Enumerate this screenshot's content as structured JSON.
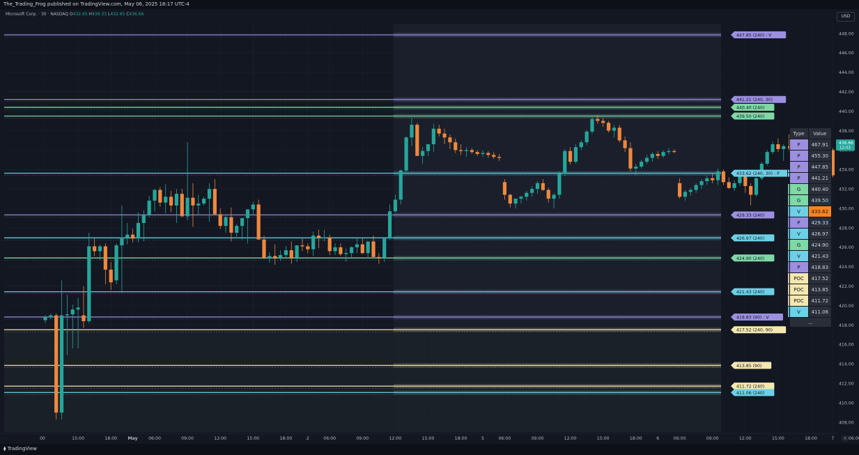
{
  "header": {
    "publisher": "The_Trading_Frog published on TradingView.com, May 06, 2025 18:17 UTC-4",
    "currency": "USD",
    "symbol": "Microsoft Corp. · 30 · NASDAQ",
    "ohlc": [
      {
        "k": "O",
        "v": "432.65"
      },
      {
        "k": "H",
        "v": "439.33"
      },
      {
        "k": "L",
        "v": "432.65"
      },
      {
        "k": "C",
        "v": "436.66"
      }
    ]
  },
  "footer": {
    "logo": "TradingView",
    "auto": "A"
  },
  "colors": {
    "background": "#131722",
    "up": "#26a69a",
    "down": "#f0883e",
    "p": "#9c8fe0",
    "g": "#7fd8a6",
    "v": "#6dd0e6",
    "poc": "#f5e7b0"
  },
  "chart_data": {
    "type": "candlestick",
    "ylim": [
      407,
      449
    ],
    "y_ticks": [
      "448.00",
      "446.00",
      "444.00",
      "442.00",
      "440.00",
      "438.00",
      "436.00",
      "434.00",
      "432.00",
      "430.00",
      "428.00",
      "426.00",
      "424.00",
      "422.00",
      "420.00",
      "418.00",
      "416.00",
      "414.00",
      "412.00",
      "410.00",
      "408.00"
    ],
    "last_price": {
      "value": "436.66",
      "countdown": "12:03"
    },
    "x_ticks": [
      {
        "label": "00",
        "bar": -0.5
      },
      {
        "label": "15:00",
        "bar": 6
      },
      {
        "label": "18:00",
        "bar": 12
      },
      {
        "label": "May",
        "bar": 16,
        "bold": true
      },
      {
        "label": "06:00",
        "bar": 20
      },
      {
        "label": "09:00",
        "bar": 26
      },
      {
        "label": "12:00",
        "bar": 32
      },
      {
        "label": "15:00",
        "bar": 38
      },
      {
        "label": "18:00",
        "bar": 44
      },
      {
        "label": "2",
        "bar": 48
      },
      {
        "label": "06:00",
        "bar": 52
      },
      {
        "label": "09:00",
        "bar": 58
      },
      {
        "label": "12:00",
        "bar": 64
      },
      {
        "label": "15:00",
        "bar": 70
      },
      {
        "label": "18:00",
        "bar": 76
      },
      {
        "label": "5",
        "bar": 80
      },
      {
        "label": "06:00",
        "bar": 84
      },
      {
        "label": "09:00",
        "bar": 90
      },
      {
        "label": "12:00",
        "bar": 96
      },
      {
        "label": "15:00",
        "bar": 102
      },
      {
        "label": "18:00",
        "bar": 108
      },
      {
        "label": "6",
        "bar": 112
      },
      {
        "label": "06:00",
        "bar": 116
      },
      {
        "label": "09:00",
        "bar": 122
      },
      {
        "label": "12:00",
        "bar": 128
      },
      {
        "label": "15:00",
        "bar": 134
      },
      {
        "label": "18:00",
        "bar": 140
      },
      {
        "label": "7",
        "bar": 144
      },
      {
        "label": "06:00",
        "bar": 148
      },
      {
        "label": "09:00",
        "bar": 154
      },
      {
        "label": "12:00",
        "bar": 160
      }
    ],
    "candles": [
      [
        418.5,
        419.0,
        418.2,
        418.8
      ],
      [
        418.8,
        419.2,
        418.6,
        419.0
      ],
      [
        419.0,
        419.2,
        408.3,
        409.0
      ],
      [
        409.0,
        422.6,
        408.3,
        419.0
      ],
      [
        419.0,
        421.1,
        414.9,
        419.1
      ],
      [
        419.1,
        420.1,
        415.6,
        419.6
      ],
      [
        419.6,
        420.8,
        415.6,
        419.8
      ],
      [
        419.0,
        422.0,
        417.7,
        418.4
      ],
      [
        418.4,
        427.5,
        418.2,
        426.1
      ],
      [
        426.1,
        426.9,
        425.1,
        425.6
      ],
      [
        425.6,
        426.3,
        424.7,
        426.1
      ],
      [
        426.1,
        426.4,
        422.2,
        423.7
      ],
      [
        423.7,
        424.5,
        421.6,
        422.4
      ],
      [
        422.6,
        426.4,
        422.2,
        426.2
      ],
      [
        426.2,
        430.3,
        421.3,
        427.0
      ],
      [
        427.0,
        428.5,
        426.3,
        427.3
      ],
      [
        427.3,
        427.9,
        426.5,
        426.9
      ],
      [
        426.9,
        429.6,
        426.5,
        428.5
      ],
      [
        428.5,
        429.8,
        426.6,
        429.3
      ],
      [
        429.3,
        431.3,
        429.1,
        430.8
      ],
      [
        430.8,
        432.0,
        429.7,
        431.9
      ],
      [
        431.9,
        432.2,
        430.2,
        430.6
      ],
      [
        430.6,
        432.5,
        429.5,
        431.2
      ],
      [
        431.2,
        431.8,
        429.6,
        430.3
      ],
      [
        430.3,
        432.0,
        428.5,
        431.5
      ],
      [
        431.5,
        432.0,
        429.1,
        429.2
      ],
      [
        429.2,
        436.8,
        428.8,
        431.1
      ],
      [
        431.1,
        432.6,
        428.1,
        430.3
      ],
      [
        430.3,
        431.4,
        429.4,
        430.5
      ],
      [
        430.5,
        431.2,
        430.3,
        431.0
      ],
      [
        431.0,
        432.6,
        428.6,
        432.0
      ],
      [
        432.0,
        433.0,
        431.2,
        429.4
      ],
      [
        429.4,
        430.0,
        427.9,
        428.2
      ],
      [
        428.2,
        429.3,
        427.5,
        429.1
      ],
      [
        429.1,
        430.1,
        426.6,
        427.5
      ],
      [
        427.5,
        428.4,
        427.1,
        428.2
      ],
      [
        428.2,
        428.8,
        426.8,
        429.0
      ],
      [
        429.0,
        429.9,
        426.4,
        429.9
      ],
      [
        429.9,
        430.7,
        429.4,
        430.4
      ],
      [
        430.4,
        430.9,
        427.6,
        426.8
      ],
      [
        426.8,
        427.2,
        424.8,
        424.9
      ],
      [
        424.9,
        425.5,
        424.4,
        425.1
      ],
      [
        425.1,
        426.3,
        424.2,
        424.9
      ],
      [
        424.9,
        425.7,
        424.6,
        425.2
      ],
      [
        425.2,
        426.1,
        424.9,
        425.7
      ],
      [
        425.7,
        426.6,
        424.3,
        424.9
      ],
      [
        424.9,
        425.8,
        424.5,
        426.2
      ],
      [
        426.2,
        426.9,
        425.6,
        426.1
      ],
      [
        426.1,
        426.4,
        425.4,
        425.8
      ],
      [
        425.8,
        427.6,
        425.1,
        427.2
      ],
      [
        427.2,
        427.8,
        425.9,
        427.0
      ],
      [
        427.0,
        427.8,
        426.6,
        427.0
      ],
      [
        427.0,
        427.3,
        425.2,
        425.6
      ],
      [
        425.6,
        426.4,
        425.2,
        426.0
      ],
      [
        426.0,
        426.4,
        425.1,
        425.3
      ],
      [
        425.3,
        425.9,
        424.5,
        425.4
      ],
      [
        425.4,
        426.1,
        425.0,
        426.0
      ],
      [
        426.0,
        426.9,
        425.4,
        426.3
      ],
      [
        426.3,
        426.9,
        425.3,
        425.4
      ],
      [
        425.4,
        426.5,
        424.9,
        426.6
      ],
      [
        426.6,
        427.2,
        425.0,
        425.0
      ],
      [
        425.0,
        425.4,
        424.3,
        424.9
      ],
      [
        424.9,
        426.2,
        424.5,
        426.9
      ],
      [
        426.9,
        430.4,
        426.8,
        429.7
      ],
      [
        429.7,
        431.4,
        429.6,
        430.9
      ],
      [
        430.9,
        434.0,
        430.4,
        433.9
      ],
      [
        433.9,
        437.4,
        433.6,
        437.3
      ],
      [
        437.3,
        439.3,
        436.4,
        438.6
      ],
      [
        438.6,
        438.8,
        435.5,
        435.4
      ],
      [
        435.4,
        436.3,
        434.6,
        435.9
      ],
      [
        435.9,
        436.4,
        435.4,
        436.6
      ],
      [
        436.6,
        438.7,
        435.8,
        438.2
      ],
      [
        438.2,
        438.6,
        437.4,
        437.7
      ],
      [
        437.7,
        438.2,
        436.6,
        437.3
      ],
      [
        437.3,
        437.6,
        436.1,
        436.8
      ],
      [
        436.8,
        437.2,
        435.7,
        436.0
      ],
      [
        436.0,
        436.6,
        435.5,
        435.9
      ],
      [
        435.9,
        436.3,
        435.3,
        436.0
      ],
      [
        436.0,
        436.2,
        435.6,
        435.8
      ],
      [
        435.8,
        436.0,
        435.4,
        435.6
      ],
      [
        435.6,
        436.0,
        435.3,
        435.7
      ],
      [
        435.7,
        435.9,
        435.2,
        435.5
      ],
      [
        435.5,
        435.8,
        435.1,
        435.3
      ],
      [
        435.3,
        435.6,
        434.9,
        435.2
      ],
      [
        432.7,
        433.0,
        430.9,
        431.4
      ],
      [
        431.4,
        431.5,
        430.1,
        430.5
      ],
      [
        430.5,
        431.0,
        430.0,
        431.0
      ],
      [
        431.0,
        431.3,
        430.5,
        431.2
      ],
      [
        431.2,
        431.8,
        430.8,
        431.6
      ],
      [
        431.6,
        432.3,
        431.2,
        432.0
      ],
      [
        432.0,
        432.8,
        431.5,
        432.6
      ],
      [
        432.6,
        433.0,
        431.8,
        431.9
      ],
      [
        431.9,
        432.1,
        430.6,
        431.0
      ],
      [
        431.0,
        431.6,
        430.0,
        431.4
      ],
      [
        431.4,
        433.8,
        431.0,
        433.6
      ],
      [
        433.6,
        436.1,
        433.3,
        435.9
      ],
      [
        435.9,
        436.3,
        434.5,
        434.8
      ],
      [
        434.8,
        436.6,
        434.6,
        436.3
      ],
      [
        436.3,
        437.0,
        436.0,
        436.8
      ],
      [
        436.8,
        438.1,
        436.5,
        437.9
      ],
      [
        437.9,
        439.4,
        437.7,
        439.2
      ],
      [
        439.2,
        439.6,
        438.7,
        439.0
      ],
      [
        439.0,
        439.3,
        438.4,
        438.8
      ],
      [
        438.8,
        439.0,
        437.8,
        438.0
      ],
      [
        438.0,
        438.6,
        437.3,
        438.3
      ],
      [
        438.3,
        438.6,
        436.8,
        437.0
      ],
      [
        437.0,
        437.4,
        435.8,
        436.2
      ],
      [
        436.2,
        436.8,
        433.8,
        434.1
      ],
      [
        434.1,
        434.6,
        433.4,
        434.3
      ],
      [
        434.3,
        435.0,
        434.1,
        434.8
      ],
      [
        434.8,
        435.5,
        434.6,
        435.2
      ],
      [
        435.2,
        435.8,
        434.8,
        435.6
      ],
      [
        435.6,
        435.9,
        435.1,
        435.4
      ],
      [
        435.4,
        436.0,
        435.2,
        435.8
      ],
      [
        435.8,
        436.2,
        435.6,
        435.9
      ],
      [
        435.9,
        436.1,
        435.7,
        435.8
      ],
      [
        432.6,
        433.1,
        431.0,
        431.2
      ],
      [
        431.2,
        431.9,
        430.8,
        431.7
      ],
      [
        431.7,
        432.1,
        431.3,
        431.9
      ],
      [
        431.9,
        432.6,
        431.6,
        432.4
      ],
      [
        432.4,
        433.0,
        432.0,
        432.8
      ],
      [
        432.8,
        433.4,
        432.4,
        433.1
      ],
      [
        433.1,
        433.6,
        432.6,
        432.9
      ],
      [
        432.9,
        434.1,
        432.4,
        433.8
      ],
      [
        433.8,
        434.0,
        432.4,
        432.7
      ],
      [
        432.7,
        433.2,
        432.0,
        432.1
      ],
      [
        432.1,
        432.9,
        431.8,
        432.6
      ],
      [
        432.6,
        433.5,
        432.3,
        433.3
      ],
      [
        433.3,
        433.9,
        431.6,
        432.3
      ],
      [
        432.3,
        432.6,
        430.3,
        431.4
      ],
      [
        431.4,
        433.2,
        431.2,
        433.1
      ],
      [
        433.1,
        434.8,
        432.9,
        434.6
      ],
      [
        434.6,
        436.0,
        434.4,
        435.8
      ],
      [
        435.8,
        436.9,
        435.6,
        436.6
      ],
      [
        436.6,
        437.2,
        435.8,
        436.1
      ],
      [
        436.1,
        436.6,
        434.9,
        436.4
      ],
      [
        436.4,
        437.6,
        435.9,
        436.2
      ],
      [
        436.2,
        436.9,
        435.7,
        436.7
      ],
      [
        436.7,
        436.9,
        434.9,
        435.3
      ],
      [
        435.3,
        436.2,
        435.0,
        435.9
      ],
      [
        435.9,
        436.4,
        435.4,
        436.0
      ],
      [
        436.0,
        436.4,
        434.7,
        435.1
      ],
      [
        435.1,
        435.6,
        434.9,
        435.4
      ],
      [
        435.4,
        436.1,
        435.1,
        436.0
      ],
      [
        436.0,
        436.2,
        433.2,
        433.4
      ],
      [
        433.4,
        433.7,
        431.5,
        431.8
      ],
      [
        431.8,
        432.8,
        431.3,
        432.6
      ],
      [
        432.6,
        433.0,
        432.3,
        432.7
      ],
      [
        432.7,
        439.3,
        432.6,
        436.7
      ]
    ],
    "levels": [
      {
        "price": 447.85,
        "label": "447.85 (240) : V",
        "kind": "p",
        "from": 0
      },
      {
        "price": 441.21,
        "label": "441.21 (240, 30)",
        "kind": "p",
        "from": 0
      },
      {
        "price": 440.4,
        "label": "440.40 (240)",
        "kind": "g",
        "from": 0
      },
      {
        "price": 439.5,
        "label": "439.50 (240)",
        "kind": "g",
        "from": 0
      },
      {
        "price": 433.62,
        "label": "433.62 (240, 30) : P",
        "kind": "v",
        "from": 0
      },
      {
        "price": 429.33,
        "label": "429.33 (240)",
        "kind": "p",
        "from": 0
      },
      {
        "price": 426.97,
        "label": "426.97 (240)",
        "kind": "v",
        "from": 0
      },
      {
        "price": 424.9,
        "label": "424.90 (240)",
        "kind": "g",
        "from": 0
      },
      {
        "price": 421.43,
        "label": "421.43 (240)",
        "kind": "v",
        "from": 0
      },
      {
        "price": 418.83,
        "label": "418.83 (90) : V",
        "kind": "p",
        "from": 0
      },
      {
        "price": 417.52,
        "label": "417.52 (240, 90)",
        "kind": "poc",
        "from": 0
      },
      {
        "price": 413.85,
        "label": "413.85 (90)",
        "kind": "poc",
        "from": 0
      },
      {
        "price": 411.72,
        "label": "411.72 (240)",
        "kind": "poc",
        "from": 0
      },
      {
        "price": 411.06,
        "label": "411.06 (240)",
        "kind": "v",
        "from": 0
      }
    ],
    "level_table": {
      "headers": [
        "Type",
        "Value"
      ],
      "rows": [
        {
          "type": "P",
          "value": "467.91",
          "kind": "p"
        },
        {
          "type": "P",
          "value": "455.30",
          "kind": "p"
        },
        {
          "type": "P",
          "value": "447.85",
          "kind": "p"
        },
        {
          "type": "P",
          "value": "441.21",
          "kind": "p"
        },
        {
          "type": "G",
          "value": "440.40",
          "kind": "g"
        },
        {
          "type": "G",
          "value": "439.50",
          "kind": "g"
        },
        {
          "type": "V",
          "value": "433.62",
          "kind": "v",
          "highlight": true
        },
        {
          "type": "P",
          "value": "429.33",
          "kind": "p"
        },
        {
          "type": "V",
          "value": "426.97",
          "kind": "v"
        },
        {
          "type": "G",
          "value": "424.90",
          "kind": "g"
        },
        {
          "type": "V",
          "value": "421.43",
          "kind": "v"
        },
        {
          "type": "P",
          "value": "418.83",
          "kind": "p"
        },
        {
          "type": "POC",
          "value": "417.52",
          "kind": "poc"
        },
        {
          "type": "POC",
          "value": "413.85",
          "kind": "poc"
        },
        {
          "type": "POC",
          "value": "411.72",
          "kind": "poc"
        },
        {
          "type": "V",
          "value": "411.06",
          "kind": "v"
        }
      ],
      "more": "..."
    }
  }
}
